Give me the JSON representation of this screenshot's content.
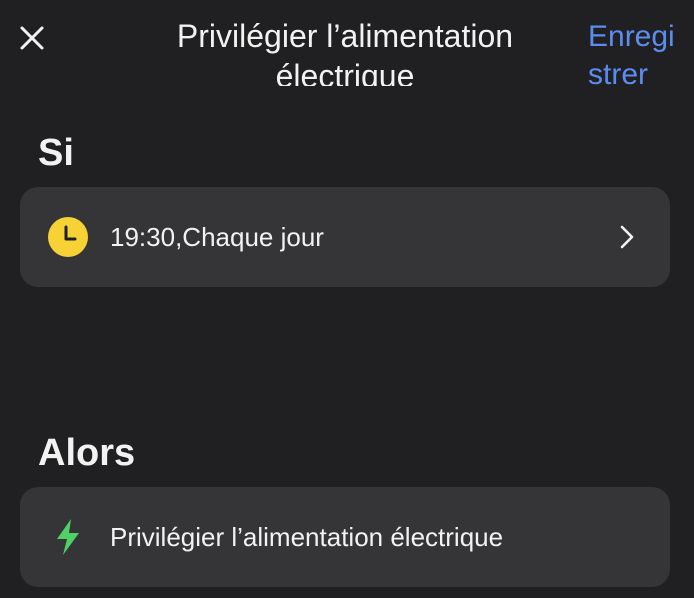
{
  "header": {
    "title": "Privilégier l’alimentation électrique",
    "save_label": "Enregistrer",
    "close_icon": "close-icon"
  },
  "condition": {
    "section_label": "Si",
    "trigger_text": "19:30,Chaque jour",
    "icon": "clock-icon",
    "icon_color": "#f6d235",
    "chevron_icon": "chevron-right-icon"
  },
  "action": {
    "section_label": "Alors",
    "action_text": "Privilégier l’alimentation électrique",
    "icon": "lightning-bolt-icon",
    "icon_color": "#4fd163"
  },
  "colors": {
    "background": "#202022",
    "card": "#353538",
    "accent": "#5b8df0",
    "text": "#f2f2f2"
  }
}
